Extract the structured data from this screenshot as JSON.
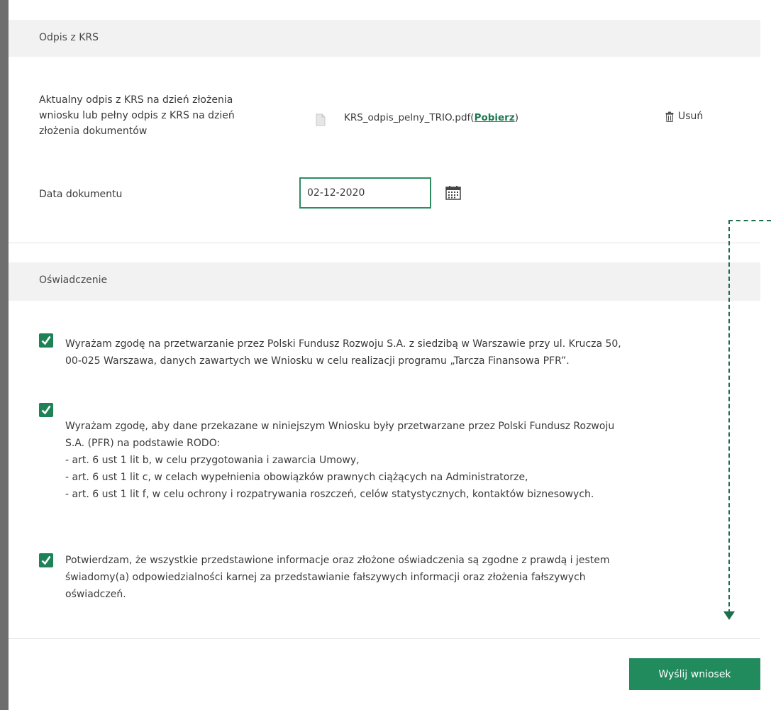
{
  "krs_section": {
    "title": "Odpis z KRS",
    "description_lines": [
      "Aktualny odpis z KRS na dzień złożenia",
      "wniosku lub pełny odpis z KRS na dzień",
      "złożenia dokumentów"
    ],
    "file_name": "KRS_odpis_pelny_TRIO.pdf",
    "download_open": "(",
    "download_label": "Pobierz",
    "download_close": ")",
    "delete_label": "Usuń",
    "date_label": "Data dokumentu",
    "date_value": "02-12-2020"
  },
  "statement_section": {
    "title": "Oświadczenie",
    "consents": [
      {
        "checked": true,
        "lines": [
          "Wyrażam zgodę na przetwarzanie przez Polski Fundusz Rozwoju S.A. z siedzibą w Warszawie przy ul. Krucza 50,",
          "00-025 Warszawa, danych zawartych we Wniosku w celu realizacji programu „Tarcza Finansowa PFR”."
        ]
      },
      {
        "checked": true,
        "lines": [
          "Wyrażam zgodę, aby dane przekazane w niniejszym Wniosku były przetwarzane przez Polski Fundusz Rozwoju",
          "S.A. (PFR) na podstawie RODO:",
          "- art. 6 ust 1 lit b, w celu przygotowania i zawarcia Umowy,",
          "- art. 6 ust 1 lit c, w celach wypełnienia obowiązków prawnych ciążących na Administratorze,",
          "- art. 6 ust 1 lit f, w celu ochrony i rozpatrywania roszczeń, celów statystycznych, kontaktów biznesowych."
        ]
      },
      {
        "checked": true,
        "lines": [
          "Potwierdzam, że wszystkie przedstawione informacje oraz złożone oświadczenia są zgodne z prawdą i jestem",
          "świadomy(a) odpowiedzialności karnej za przedstawianie fałszywych informacji oraz złożenia fałszywych",
          "oświadczeń."
        ]
      }
    ]
  },
  "submit_label": "Wyślij wniosek",
  "colors": {
    "accent": "#218b5e",
    "link": "#1b7a52",
    "header_bg": "#f2f2f2"
  }
}
